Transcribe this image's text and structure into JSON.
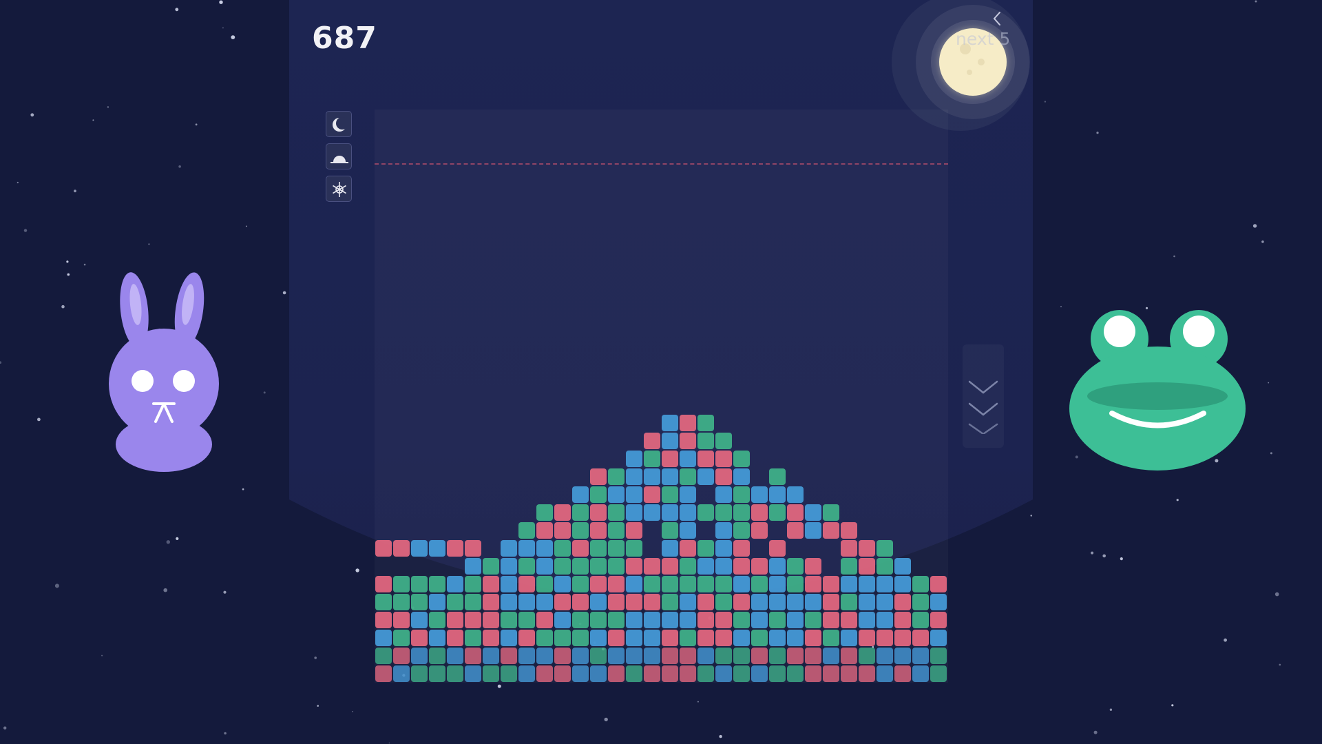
{
  "game": {
    "score": "687",
    "next_label": "next 5"
  },
  "icons": {
    "collapse": "chevron-left-icon",
    "tools": [
      "moon-icon",
      "sunrise-icon",
      "snowflake-icon"
    ],
    "drop": "triple-chevron-down-icon"
  },
  "characters": {
    "left": "purple-bunny",
    "right": "green-frog"
  },
  "colors": {
    "background": "#141a3c",
    "panel": "#1d2552",
    "green": "#3faf88",
    "pink": "#e0667e",
    "blue": "#4599d6",
    "bunny": "#9a86ec",
    "frog": "#3dbf96",
    "moon": "#f6ecc7"
  }
}
